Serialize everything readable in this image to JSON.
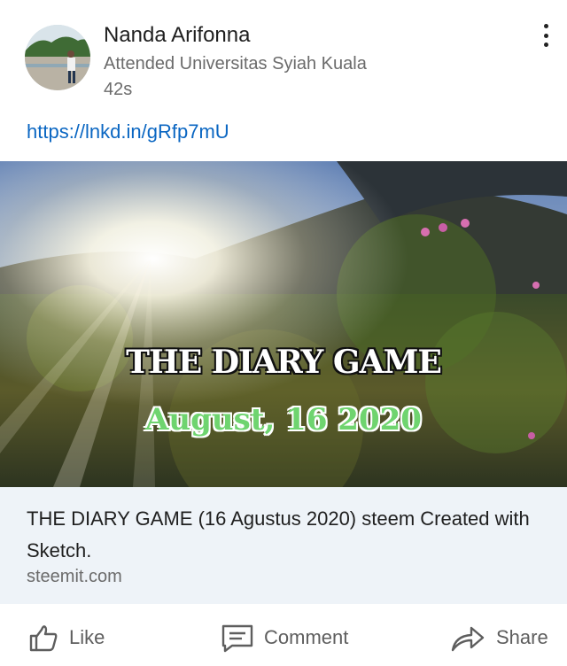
{
  "post": {
    "author": {
      "name": "Nanda Arifonna",
      "headline": "Attended Universitas Syiah Kuala",
      "time_ago": "42s"
    },
    "link_text": "https://lnkd.in/gRfp7mU",
    "image": {
      "title_line_1": "THE DIARY GAME",
      "title_line_2": "August, 16 2020"
    },
    "card": {
      "title": "THE DIARY GAME (16 Agustus 2020) steem Created with Sketch.",
      "domain": "steemit.com"
    }
  },
  "actions": {
    "like_label": "Like",
    "comment_label": "Comment",
    "share_label": "Share"
  },
  "icons": {
    "more": "more-vertical-icon",
    "like": "thumbs-up-icon",
    "comment": "comment-icon",
    "share": "share-arrow-icon"
  },
  "colors": {
    "link": "#0a66c2",
    "card_background": "#eef3f8",
    "subtitle_text": "#6b6b6b"
  }
}
